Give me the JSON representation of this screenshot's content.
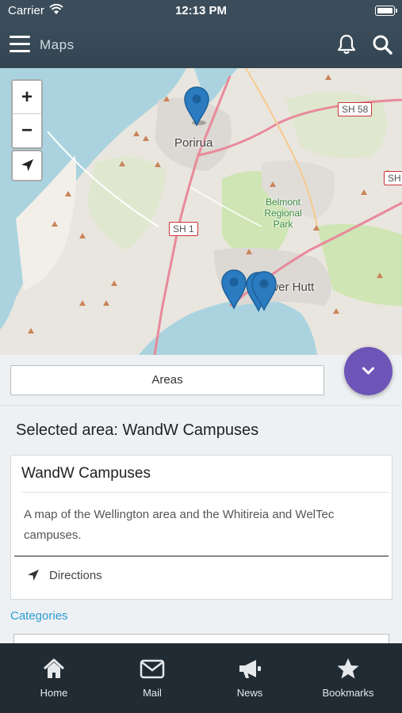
{
  "status_bar": {
    "carrier": "Carrier",
    "time": "12:13 PM"
  },
  "header": {
    "title": "Maps"
  },
  "map": {
    "labels": {
      "porirua": "Porirua",
      "lower_hutt": "ower Hutt",
      "belmont": "Belmont Regional Park"
    },
    "road_shields": {
      "sh58": "SH 58",
      "sh1": "SH 1",
      "sh_right": "SH"
    },
    "zoom_in": "+",
    "zoom_out": "−"
  },
  "areas_button": "Areas",
  "selected_area_heading": "Selected area: WandW Campuses",
  "card": {
    "title": "WandW Campuses",
    "description": "A map of the Wellington area and the Whitireia and WelTec campuses.",
    "directions_label": "Directions"
  },
  "categories_label": "Categories",
  "tabs": [
    {
      "label": "Home",
      "icon": "home-icon"
    },
    {
      "label": "Mail",
      "icon": "mail-icon"
    },
    {
      "label": "News",
      "icon": "megaphone-icon"
    },
    {
      "label": "Bookmarks",
      "icon": "star-icon"
    }
  ],
  "colors": {
    "header": "#3b4d5b",
    "accent": "#6d55b8",
    "link": "#2a9bd6",
    "tabbar": "#212b33",
    "pin": "#2b7bc0"
  }
}
